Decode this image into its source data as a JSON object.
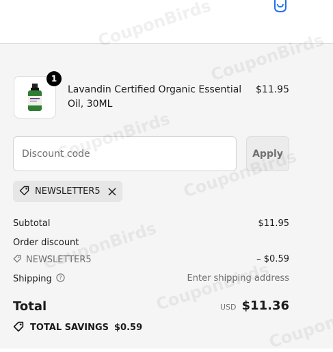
{
  "cart": {
    "icon": "shopping-bag-icon"
  },
  "product": {
    "name": "Lavandin Certified Organic Essential Oil, 30ML",
    "price": "$11.95",
    "quantity": "1",
    "image_icon": "essential-oil-bottle"
  },
  "discount": {
    "placeholder": "Discount code",
    "apply_label": "Apply",
    "applied_code": "NEWSLETTER5"
  },
  "summary": {
    "subtotal_label": "Subtotal",
    "subtotal_value": "$11.95",
    "order_discount_label": "Order discount",
    "order_discount_code": "NEWSLETTER5",
    "order_discount_value": "– $0.59",
    "shipping_label": "Shipping",
    "shipping_value": "Enter shipping address"
  },
  "total": {
    "label": "Total",
    "currency": "USD",
    "amount": "$11.36",
    "savings_label": "TOTAL SAVINGS",
    "savings_value": "$0.59"
  },
  "watermark": "CouponBirds",
  "colors": {
    "accent": "#1a73e8",
    "text": "#1a1a1a",
    "muted": "#707070",
    "panel": "#f5f5f5"
  }
}
